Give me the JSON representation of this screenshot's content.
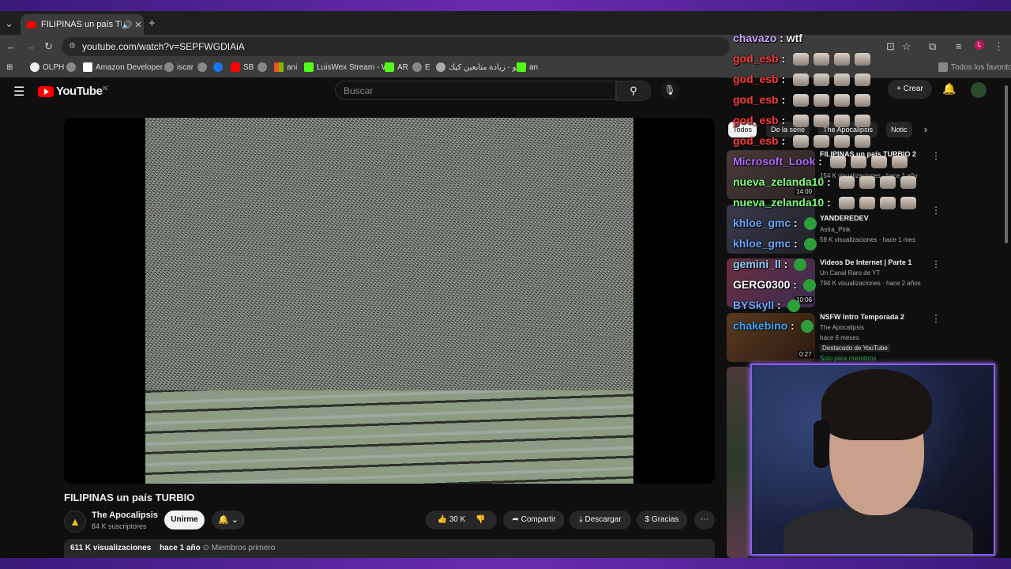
{
  "browser": {
    "tab_title": "FILIPINAS un país TURBIO -",
    "url": "youtube.com/watch?v=SEPFWGDIAiA",
    "bookmarks": [
      "OLPH",
      "Amazon Developer...",
      "iscar",
      "SB",
      "ani",
      "LuisWex Stream - W...",
      "AR",
      "E",
      "بلو - زيادة متابعين كيك",
      "an"
    ],
    "all_bookmarks": "Todos los favoritos"
  },
  "youtube": {
    "logo": "YouTube",
    "region": "PE",
    "search_placeholder": "Buscar",
    "create_label": "Crear",
    "chips": [
      "Todos",
      "De la serie",
      "The Apocalipsis",
      "Notic"
    ]
  },
  "video": {
    "title": "FILIPINAS un país TURBIO",
    "channel": "The Apocalipsis",
    "subscribers": "84 K suscriptores",
    "join_label": "Unirme",
    "likes": "30 K",
    "share_label": "Compartir",
    "download_label": "Descargar",
    "thanks_label": "Gracias",
    "views": "611 K visualizaciones",
    "age": "hace 1 año",
    "members_first": "Miembros primero"
  },
  "recommendations": [
    {
      "title": "FILIPINAS un país TURBIO 2",
      "meta": "154 K visualizaciones · hace 1 año",
      "channel": "",
      "duration": "14:00"
    },
    {
      "title": "YANDEREDEV",
      "channel": "Astra_Pink",
      "meta": "59 K visualizaciones · hace 1 mes",
      "duration": ""
    },
    {
      "title": "Videos De Internet | Parte 1",
      "channel": "Un Canal Raro de YT",
      "meta": "794 K visualizaciones · hace 2 años",
      "duration": "10:06"
    },
    {
      "title": "NSFW Intro Temporada 2",
      "channel": "The Apocalipsis",
      "meta": "hace 6 meses",
      "badge": "Destacado de YouTube",
      "members": "Solo para miembros",
      "duration": "0:27"
    }
  ],
  "chat": [
    {
      "user": "chavazo",
      "text": "wtf",
      "color": "#c9a6ff"
    },
    {
      "user": "god_esb",
      "text": "",
      "color": "#ff3b3b",
      "emotes": 4
    },
    {
      "user": "god_esb",
      "text": "",
      "color": "#ff3b3b",
      "emotes": 4
    },
    {
      "user": "god_esb",
      "text": "",
      "color": "#ff3b3b",
      "emotes": 4
    },
    {
      "user": "god_esb",
      "text": "",
      "color": "#ff3b3b",
      "emotes": 4
    },
    {
      "user": "god_esb",
      "text": "",
      "color": "#ff3b3b",
      "emotes": 4
    },
    {
      "user": "Microsoft_Look",
      "text": "",
      "color": "#b36bff",
      "emotes": 4
    },
    {
      "user": "nueva_zelanda10",
      "text": "",
      "color": "#7dff7d",
      "emotes": 4
    },
    {
      "user": "nueva_zelanda10",
      "text": "",
      "color": "#7dff7d",
      "emotes": 4
    },
    {
      "user": "khloe_gmc",
      "text": "",
      "color": "#6aa8ff",
      "emotes": 0
    },
    {
      "user": "khloe_gmc",
      "text": "",
      "color": "#6aa8ff",
      "emotes": 0
    },
    {
      "user": "gemini_ll",
      "text": "",
      "color": "#8fd3ff",
      "emotes": 0
    },
    {
      "user": "GERG0300",
      "text": "",
      "color": "#ffffff",
      "emotes": 0
    },
    {
      "user": "BYSkyll",
      "text": "",
      "color": "#6aa8ff",
      "emotes": 0
    },
    {
      "user": "chakebino",
      "text": "",
      "color": "#3fa9ff",
      "emotes": 0
    }
  ]
}
